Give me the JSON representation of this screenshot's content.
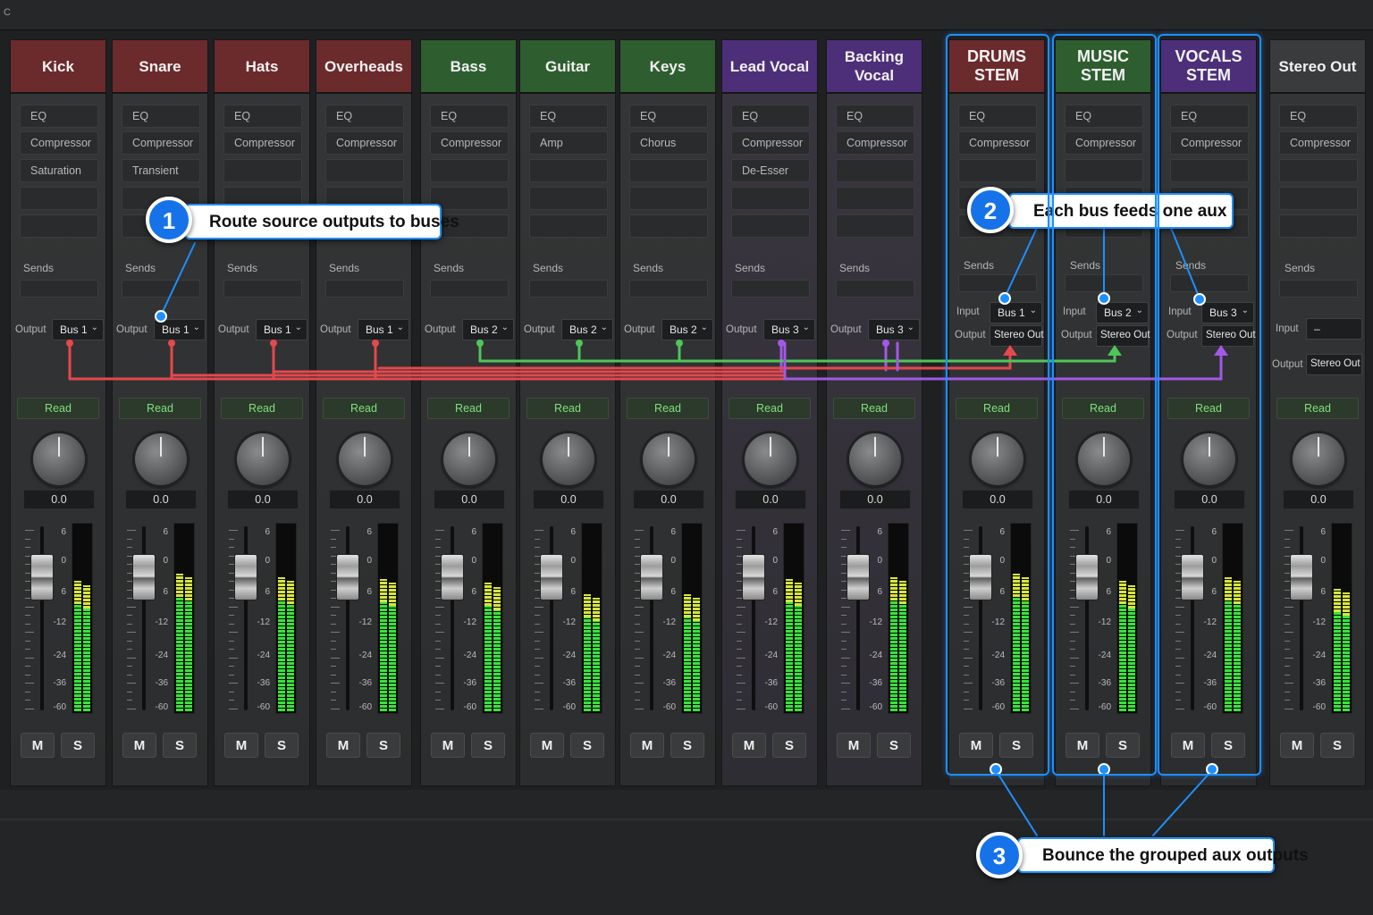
{
  "topbar": {
    "tag": "C"
  },
  "meter_scale": [
    "6",
    "0",
    "6",
    "-12",
    "-24",
    "-36",
    "-60"
  ],
  "labels": {
    "sends": "Sends",
    "output": "Output",
    "input": "Input",
    "mute": "M",
    "solo": "S"
  },
  "colors": {
    "red_route": "#e5484d",
    "green_route": "#4ec65a",
    "purple_route": "#a259e6",
    "callout_blue": "#1e8fff",
    "read_green": "#7ee07a"
  },
  "channels": [
    {
      "name": "Kick",
      "header_color": "#6b2a2c",
      "inserts": [
        "EQ",
        "Compressor",
        "Saturation",
        "",
        ""
      ],
      "output": "Bus 1",
      "automation": "Read",
      "volume": "0.0",
      "meter_level": 0.7
    },
    {
      "name": "Snare",
      "header_color": "#6b2a2c",
      "inserts": [
        "EQ",
        "Compressor",
        "Transient",
        "",
        ""
      ],
      "output": "Bus 1",
      "automation": "Read",
      "volume": "0.0",
      "meter_level": 0.74
    },
    {
      "name": "Hats",
      "header_color": "#6b2a2c",
      "inserts": [
        "EQ",
        "Compressor",
        "",
        "",
        ""
      ],
      "output": "Bus 1",
      "automation": "Read",
      "volume": "0.0",
      "meter_level": 0.72
    },
    {
      "name": "Overheads",
      "header_color": "#6b2a2c",
      "inserts": [
        "EQ",
        "Compressor",
        "",
        "",
        ""
      ],
      "output": "Bus 1",
      "automation": "Read",
      "volume": "0.0",
      "meter_level": 0.71
    },
    {
      "name": "Bass",
      "header_color": "#2e5e2f",
      "inserts": [
        "EQ",
        "Compressor",
        "",
        "",
        ""
      ],
      "output": "Bus 2",
      "automation": "Read",
      "volume": "0.0",
      "meter_level": 0.69
    },
    {
      "name": "Guitar",
      "header_color": "#2e5e2f",
      "inserts": [
        "EQ",
        "Amp",
        "",
        "",
        ""
      ],
      "output": "Bus 2",
      "automation": "Read",
      "volume": "0.0",
      "meter_level": 0.63
    },
    {
      "name": "Keys",
      "header_color": "#2e5e2f",
      "inserts": [
        "EQ",
        "Chorus",
        "",
        "",
        ""
      ],
      "output": "Bus 2",
      "automation": "Read",
      "volume": "0.0",
      "meter_level": 0.63
    },
    {
      "name": "Lead Vocal",
      "header_color": "#4c2f78",
      "inserts": [
        "EQ",
        "Compressor",
        "De-Esser",
        "",
        ""
      ],
      "output": "Bus 3",
      "automation": "Read",
      "volume": "0.0",
      "meter_level": 0.71
    },
    {
      "name": "Backing Vocal",
      "header_color": "#4c2f78",
      "inserts": [
        "EQ",
        "Compressor",
        "",
        "",
        ""
      ],
      "output": "Bus 3",
      "automation": "Read",
      "volume": "0.0",
      "meter_level": 0.72
    }
  ],
  "stems": [
    {
      "name": "DRUMS STEM",
      "header_color": "#6b2a2c",
      "inserts": [
        "EQ",
        "Compressor",
        "",
        "",
        ""
      ],
      "input": "Bus 1",
      "output": "Stereo Out",
      "automation": "Read",
      "volume": "0.0",
      "meter_level": 0.74
    },
    {
      "name": "MUSIC STEM",
      "header_color": "#2e5e2f",
      "inserts": [
        "EQ",
        "Compressor",
        "",
        "",
        ""
      ],
      "input": "Bus 2",
      "output": "Stereo Out",
      "automation": "Read",
      "volume": "0.0",
      "meter_level": 0.7
    },
    {
      "name": "VOCALS STEM",
      "header_color": "#4c2f78",
      "inserts": [
        "EQ",
        "Compressor",
        "",
        "",
        ""
      ],
      "input": "Bus 3",
      "output": "Stereo Out",
      "automation": "Read",
      "volume": "0.0",
      "meter_level": 0.72
    }
  ],
  "master": {
    "name": "Stereo Out",
    "header_color": "#3a3b3c",
    "inserts": [
      "EQ",
      "Compressor",
      "",
      "",
      ""
    ],
    "input": "–",
    "output": "Stereo Out",
    "automation": "Read",
    "volume": "0.0",
    "meter_level": 0.66
  },
  "callouts": [
    {
      "number": "1",
      "text": "Route source outputs to buses"
    },
    {
      "number": "2",
      "text": "Each bus feeds one aux"
    },
    {
      "number": "3",
      "text": "Bounce the grouped aux outputs"
    }
  ]
}
